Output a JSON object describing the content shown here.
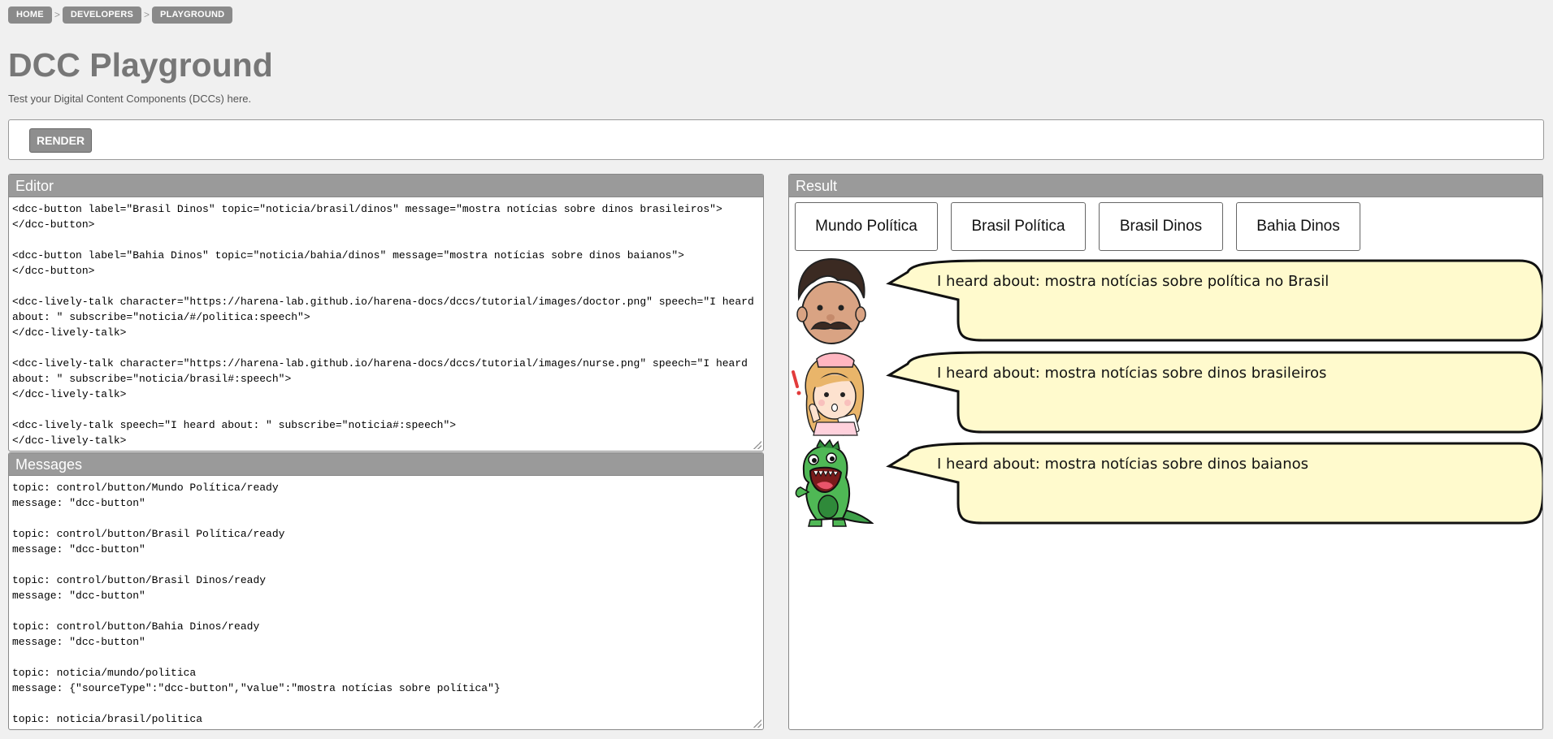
{
  "breadcrumb": {
    "items": [
      "HOME",
      "DEVELOPERS",
      "PLAYGROUND"
    ],
    "separator": ">"
  },
  "page": {
    "title": "DCC Playground",
    "subtitle": "Test your Digital Content Components (DCCs) here."
  },
  "toolbar": {
    "render_label": "RENDER"
  },
  "editor": {
    "title": "Editor",
    "code": "<dcc-button label=\"Brasil Dinos\" topic=\"noticia/brasil/dinos\" message=\"mostra notícias sobre dinos brasileiros\">\n</dcc-button>\n\n<dcc-button label=\"Bahia Dinos\" topic=\"noticia/bahia/dinos\" message=\"mostra notícias sobre dinos baianos\">\n</dcc-button>\n\n<dcc-lively-talk character=\"https://harena-lab.github.io/harena-docs/dccs/tutorial/images/doctor.png\" speech=\"I heard about: \" subscribe=\"noticia/#/politica:speech\">\n</dcc-lively-talk>\n\n<dcc-lively-talk character=\"https://harena-lab.github.io/harena-docs/dccs/tutorial/images/nurse.png\" speech=\"I heard about: \" subscribe=\"noticia/brasil#:speech\">\n</dcc-lively-talk>\n\n<dcc-lively-talk speech=\"I heard about: \" subscribe=\"noticia#:speech\">\n</dcc-lively-talk>"
  },
  "messages": {
    "title": "Messages",
    "log": "topic: control/button/Mundo Política/ready\nmessage: \"dcc-button\"\n\ntopic: control/button/Brasil Política/ready\nmessage: \"dcc-button\"\n\ntopic: control/button/Brasil Dinos/ready\nmessage: \"dcc-button\"\n\ntopic: control/button/Bahia Dinos/ready\nmessage: \"dcc-button\"\n\ntopic: noticia/mundo/politica\nmessage: {\"sourceType\":\"dcc-button\",\"value\":\"mostra notícias sobre política\"}\n\ntopic: noticia/brasil/politica"
  },
  "result": {
    "title": "Result",
    "buttons": [
      "Mundo Política",
      "Brasil Política",
      "Brasil Dinos",
      "Bahia Dinos"
    ],
    "talks": [
      {
        "character": "doctor",
        "speech": "I heard about: mostra notícias sobre política no Brasil"
      },
      {
        "character": "nurse",
        "speech": "I heard about: mostra notícias sobre dinos brasileiros"
      },
      {
        "character": "dinosaur",
        "speech": "I heard about: mostra notícias sobre dinos baianos"
      }
    ]
  },
  "colors": {
    "bubble_fill": "#fffacd",
    "panel_header": "#9a9a9a",
    "breadcrumb_bg": "#8a8a8a",
    "title": "#777777"
  }
}
